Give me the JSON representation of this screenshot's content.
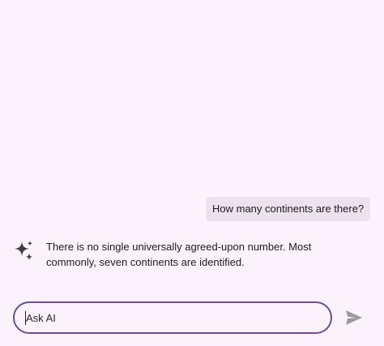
{
  "conversation": {
    "user_message": "How many continents are there?",
    "ai_message": "There is no single universally agreed-upon number.  Most commonly, seven continents are identified."
  },
  "composer": {
    "placeholder": "Ask AI",
    "value": ""
  },
  "icons": {
    "ai_avatar": "sparkle-icon",
    "send": "send-icon"
  },
  "colors": {
    "background": "#fbf2fb",
    "user_bubble": "#ece2ee",
    "input_border": "#6e4e91",
    "send_icon": "#9e99a1",
    "ai_icon": "#3e3a45"
  }
}
